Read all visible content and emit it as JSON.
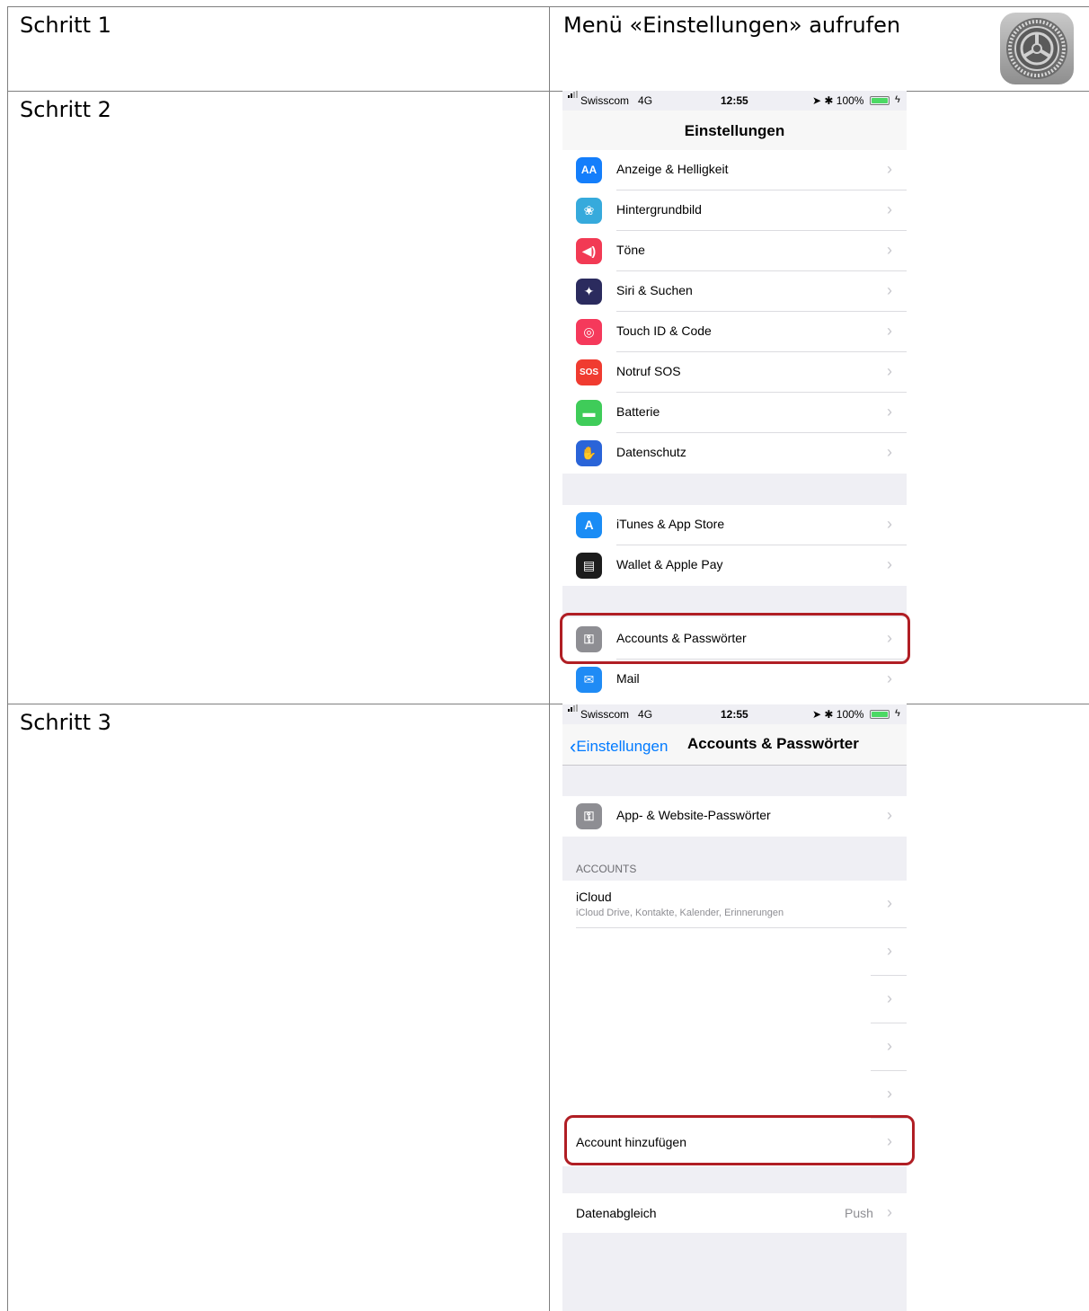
{
  "steps": [
    {
      "label": "Schritt 1",
      "instruction": "Menü «Einstellungen» aufrufen",
      "app_icon": "settings-gear-icon"
    },
    {
      "label": "Schritt 2"
    },
    {
      "label": "Schritt 3"
    }
  ],
  "colors": {
    "highlight": "#b01e24",
    "ios_blue": "#007aff",
    "chevron": "#c7c7cc",
    "group_bg": "#efeff4"
  },
  "settings_screen": {
    "status": {
      "carrier": "Swisscom",
      "network": "4G",
      "time": "12:55",
      "battery": "100%"
    },
    "title": "Einstellungen",
    "items": [
      {
        "label": "Anzeige & Helligkeit",
        "icon": "display-brightness-icon",
        "glyph": "AA",
        "color": "#147efb"
      },
      {
        "label": "Hintergrundbild",
        "icon": "wallpaper-icon",
        "glyph": "❀",
        "color": "#36aadc"
      },
      {
        "label": "Töne",
        "icon": "sounds-icon",
        "glyph": "◀)",
        "color": "#f23a54"
      },
      {
        "label": "Siri & Suchen",
        "icon": "siri-icon",
        "glyph": "✦",
        "color": "#2b2b5e"
      },
      {
        "label": "Touch ID & Code",
        "icon": "fingerprint-icon",
        "glyph": "◎",
        "color": "#f5395b"
      },
      {
        "label": "Notruf SOS",
        "icon": "sos-icon",
        "glyph": "SOS",
        "color": "#f03b30"
      },
      {
        "label": "Batterie",
        "icon": "battery-icon",
        "glyph": "▬",
        "color": "#3fcc59"
      },
      {
        "label": "Datenschutz",
        "icon": "privacy-hand-icon",
        "glyph": "✋",
        "color": "#2a64d8"
      }
    ],
    "store_items": [
      {
        "label": "iTunes & App Store",
        "icon": "app-store-icon",
        "glyph": "A",
        "color": "#1a8cf5"
      },
      {
        "label": "Wallet & Apple Pay",
        "icon": "wallet-icon",
        "glyph": "▤",
        "color": "#1c1c1c"
      }
    ],
    "account_items": [
      {
        "label": "Accounts & Passwörter",
        "icon": "key-icon",
        "glyph": "⚿",
        "color": "#8e8e93",
        "highlighted": true
      },
      {
        "label": "Mail",
        "icon": "mail-icon",
        "glyph": "✉",
        "color": "#1f8bf5"
      }
    ]
  },
  "accounts_screen": {
    "status": {
      "carrier": "Swisscom",
      "network": "4G",
      "time": "12:55",
      "battery": "100%"
    },
    "back_label": "Einstellungen",
    "title": "Accounts & Passwörter",
    "passwords_item": {
      "label": "App- & Website-Passwörter",
      "icon": "key-icon"
    },
    "section_header": "ACCOUNTS",
    "icloud": {
      "label": "iCloud",
      "detail": "iCloud Drive, Kontakte, Kalender, Erinnerungen"
    },
    "add_account": "Account hinzufügen",
    "fetch": {
      "label": "Datenabgleich",
      "value": "Push"
    }
  }
}
